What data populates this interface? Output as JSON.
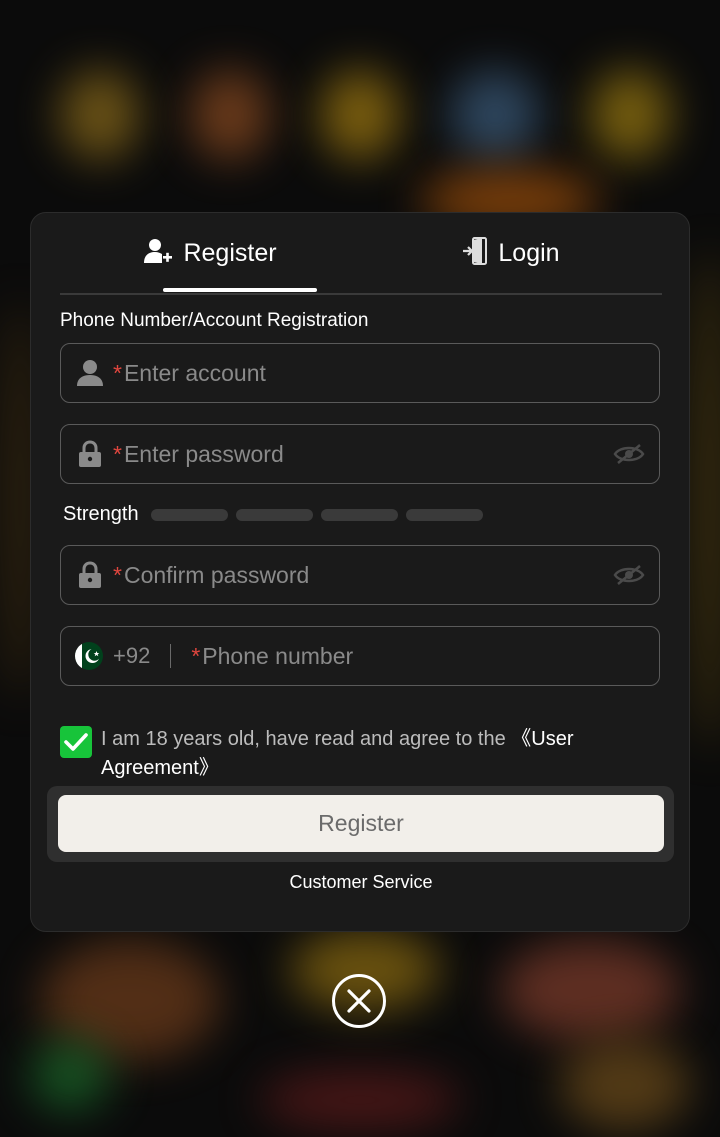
{
  "tabs": {
    "register_label": "Register",
    "login_label": "Login"
  },
  "section_title": "Phone Number/Account Registration",
  "fields": {
    "required_mark": "*",
    "account_placeholder": "Enter account",
    "password_placeholder": "Enter password",
    "confirm_placeholder": "Confirm password",
    "phone_placeholder": "Phone number",
    "dial_code": "+92"
  },
  "strength": {
    "label": "Strength",
    "level": 0,
    "segments": 4
  },
  "agreement": {
    "checked": true,
    "text": "I am 18 years old, have read and agree to the ",
    "link": "《User Agreement》"
  },
  "register_button": "Register",
  "customer_service": "Customer Service",
  "icons": {
    "register_tab": "user-plus-icon",
    "login_tab": "login-door-icon",
    "account": "user-icon",
    "password": "lock-icon",
    "eye": "eye-slash-icon",
    "flag": "pakistan-flag-icon",
    "close": "close-circle-icon"
  },
  "colors": {
    "required": "#e0463e",
    "checkbox": "#17c43a",
    "button_bg": "#f2efea",
    "modal_bg": "#1a1a1a"
  }
}
